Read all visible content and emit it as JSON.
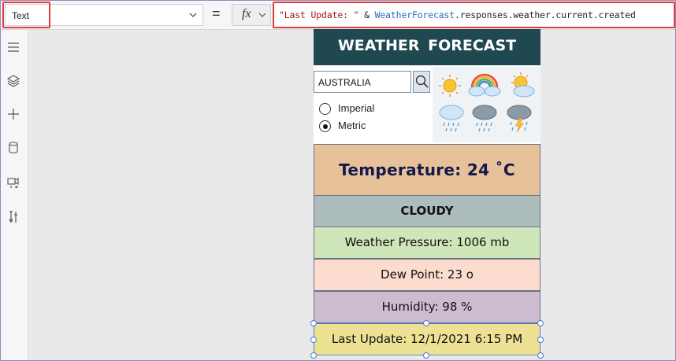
{
  "formula_bar": {
    "property": "Text",
    "equals": "=",
    "fx": "fx",
    "formula": {
      "string_literal": "\"Last Update: \"",
      "operator": " & ",
      "identifier": "WeatherForecast",
      "member_path": ".responses.weather.current.created"
    }
  },
  "left_rail": {
    "icons": [
      "hamburger-menu-icon",
      "layers-icon",
      "plus-icon",
      "database-icon",
      "media-icon",
      "tools-icon"
    ]
  },
  "app": {
    "title": "WEATHER  FORECAST",
    "search": {
      "value": "AUSTRALIA"
    },
    "units": [
      {
        "label": "Imperial",
        "selected": false
      },
      {
        "label": "Metric",
        "selected": true
      }
    ],
    "weather_icons": [
      "sun-icon",
      "rainbow-cloud-icon",
      "sun-cloud-icon",
      "rain-cloud-icon",
      "dark-rain-cloud-icon",
      "storm-cloud-icon"
    ],
    "temperature": "Temperature:  24 ˚C",
    "condition": "CLOUDY",
    "pressure": "Weather Pressure: 1006 mb",
    "dew_point": "Dew Point: 23 o",
    "humidity": "Humidity: 98 %",
    "last_update": "Last Update: 12/1/2021 6:15 PM"
  },
  "colors": {
    "header_bg": "#1f4850",
    "temp_bg": "#e7c19a",
    "cloudy_bg": "#adbdbb",
    "pressure_bg": "#cfe6b8",
    "dew_bg": "#fbdccf",
    "humidity_bg": "#cdbccf",
    "update_bg": "#ede194",
    "highlight": "#e23b3b",
    "selection": "#4a7bd1"
  }
}
